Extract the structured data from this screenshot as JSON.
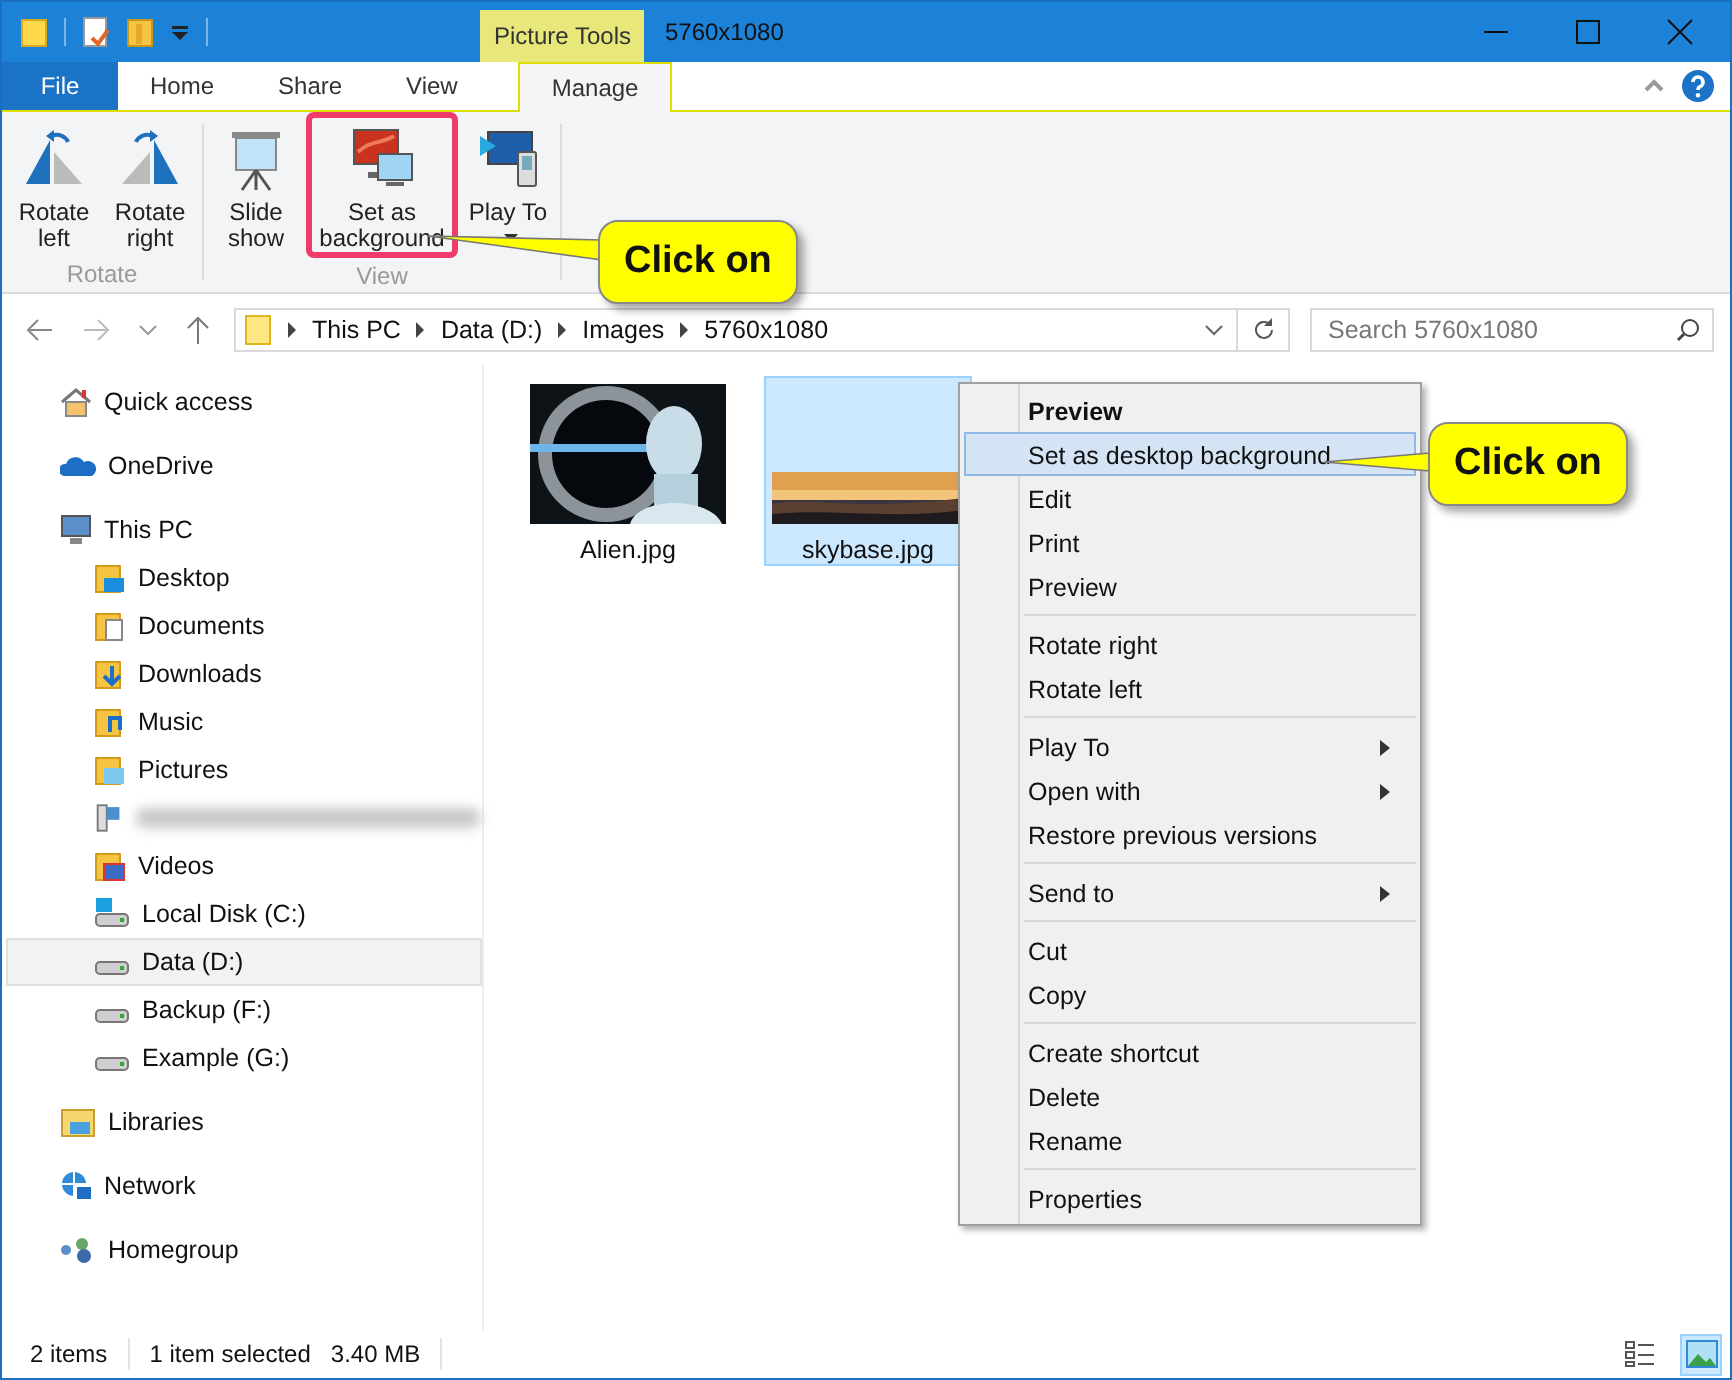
{
  "window": {
    "title": "5760x1080",
    "context_tab": "Picture Tools"
  },
  "ribbon_tabs": [
    {
      "label": "File",
      "kind": "file",
      "selected": false
    },
    {
      "label": "Home",
      "kind": "tab",
      "selected": false
    },
    {
      "label": "Share",
      "kind": "tab",
      "selected": false
    },
    {
      "label": "View",
      "kind": "tab",
      "selected": false
    },
    {
      "label": "Manage",
      "kind": "tab",
      "selected": true
    }
  ],
  "ribbon_groups": [
    {
      "name": "Rotate",
      "buttons": [
        {
          "label": "Rotate left",
          "kind": "rotate-left",
          "dropdown": false,
          "highlighted": false
        },
        {
          "label": "Rotate right",
          "kind": "rotate-right",
          "dropdown": false,
          "highlighted": false
        }
      ]
    },
    {
      "name": "View",
      "buttons": [
        {
          "label": "Slide show",
          "kind": "slideshow",
          "dropdown": false,
          "highlighted": false
        },
        {
          "label": "Set as background",
          "kind": "background",
          "dropdown": false,
          "highlighted": true
        },
        {
          "label": "Play To",
          "kind": "playto",
          "dropdown": true,
          "highlighted": false
        }
      ]
    }
  ],
  "address": {
    "segments": [
      "This PC",
      "Data (D:)",
      "Images",
      "5760x1080"
    ]
  },
  "search": {
    "placeholder": "Search 5760x1080"
  },
  "nav_pane": [
    {
      "label": "Quick access",
      "kind": "home",
      "selected": false
    },
    {
      "label": "OneDrive",
      "kind": "cloud",
      "selected": false
    },
    {
      "label": "This PC",
      "kind": "pc",
      "selected": false,
      "children": [
        {
          "label": "Desktop",
          "kind": "folder-desktop",
          "selected": false
        },
        {
          "label": "Documents",
          "kind": "folder-docs",
          "selected": false
        },
        {
          "label": "Downloads",
          "kind": "folder-down",
          "selected": false
        },
        {
          "label": "Music",
          "kind": "folder-music",
          "selected": false
        },
        {
          "label": "Pictures",
          "kind": "folder-pics",
          "selected": false
        },
        {
          "kind": "redacted",
          "selected": false
        },
        {
          "label": "Videos",
          "kind": "folder-video",
          "selected": false
        },
        {
          "label": "Local Disk (C:)",
          "kind": "drive-os",
          "selected": false
        },
        {
          "label": "Data (D:)",
          "kind": "drive",
          "selected": true
        },
        {
          "label": "Backup (F:)",
          "kind": "drive",
          "selected": false
        },
        {
          "label": "Example (G:)",
          "kind": "drive",
          "selected": false
        }
      ]
    },
    {
      "label": "Libraries",
      "kind": "libraries",
      "selected": false
    },
    {
      "label": "Network",
      "kind": "network",
      "selected": false
    },
    {
      "label": "Homegroup",
      "kind": "homegroup",
      "selected": false
    }
  ],
  "files": [
    {
      "name": "Alien.jpg",
      "kind": "picture",
      "selected": false
    },
    {
      "name": "skybase.jpg",
      "kind": "picture",
      "selected": true
    }
  ],
  "context_menu": [
    [
      {
        "label": "Preview",
        "bold": true,
        "highlighted": false,
        "submenu": false
      },
      {
        "label": "Set as desktop background",
        "bold": false,
        "highlighted": true,
        "submenu": false
      },
      {
        "label": "Edit",
        "bold": false,
        "highlighted": false,
        "submenu": false
      },
      {
        "label": "Print",
        "bold": false,
        "highlighted": false,
        "submenu": false
      },
      {
        "label": "Preview",
        "bold": false,
        "highlighted": false,
        "submenu": false
      }
    ],
    [
      {
        "label": "Rotate right",
        "bold": false,
        "highlighted": false,
        "submenu": false
      },
      {
        "label": "Rotate left",
        "bold": false,
        "highlighted": false,
        "submenu": false
      }
    ],
    [
      {
        "label": "Play To",
        "bold": false,
        "highlighted": false,
        "submenu": true
      },
      {
        "label": "Open with",
        "bold": false,
        "highlighted": false,
        "submenu": true
      },
      {
        "label": "Restore previous versions",
        "bold": false,
        "highlighted": false,
        "submenu": false
      }
    ],
    [
      {
        "label": "Send to",
        "bold": false,
        "highlighted": false,
        "submenu": true
      }
    ],
    [
      {
        "label": "Cut",
        "bold": false,
        "highlighted": false,
        "submenu": false
      },
      {
        "label": "Copy",
        "bold": false,
        "highlighted": false,
        "submenu": false
      }
    ],
    [
      {
        "label": "Create shortcut",
        "bold": false,
        "highlighted": false,
        "submenu": false
      },
      {
        "label": "Delete",
        "bold": false,
        "highlighted": false,
        "submenu": false
      },
      {
        "label": "Rename",
        "bold": false,
        "highlighted": false,
        "submenu": false
      }
    ],
    [
      {
        "label": "Properties",
        "bold": false,
        "highlighted": false,
        "submenu": false
      }
    ]
  ],
  "callouts": [
    {
      "text": "Click on"
    },
    {
      "text": "Click on"
    }
  ],
  "status_bar": {
    "item_count": "2 items",
    "selection": "1 item selected",
    "size": "3.40 MB"
  },
  "view_buttons": [
    {
      "kind": "details",
      "selected": false
    },
    {
      "kind": "large-icons",
      "selected": true
    }
  ]
}
